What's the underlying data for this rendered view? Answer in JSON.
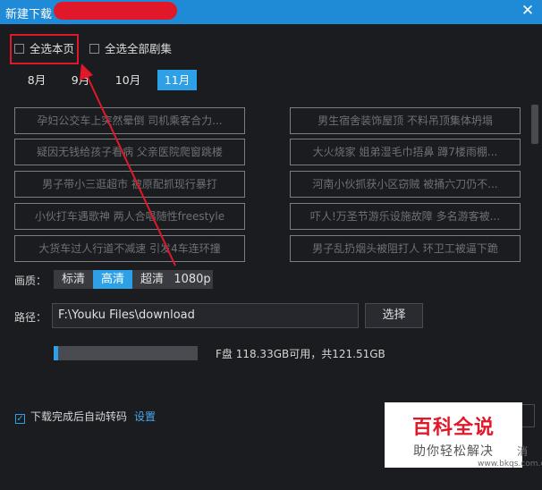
{
  "window": {
    "title": "新建下载",
    "close_glyph": "✕"
  },
  "select": {
    "select_page_label": "全选本页",
    "select_all_series_label": "全选全部剧集"
  },
  "months": [
    {
      "label": "8月",
      "active": false
    },
    {
      "label": "9月",
      "active": false
    },
    {
      "label": "10月",
      "active": false
    },
    {
      "label": "11月",
      "active": true
    }
  ],
  "videos": {
    "left": [
      "孕妇公交车上突然晕倒 司机乘客合力...",
      "疑因无钱给孩子看病 父亲医院爬窗跳楼",
      "男子带小三逛超市 被原配抓现行暴打",
      "小伙打车遇歌神 两人合唱随性freestyle",
      "大货车过人行道不减速 引发4车连环撞"
    ],
    "right": [
      "男生宿舍装饰屋顶 不料吊顶集体坍塌",
      "大火烧家 姐弟湿毛巾捂鼻 蹲7楼雨棚...",
      "河南小伙抓获小区窃贼 被捅六刀仍不...",
      "吓人!万圣节游乐设施故障 多名游客被...",
      "男子乱扔烟头被阻打人 环卫工被逼下跪"
    ]
  },
  "quality": {
    "label": "画质：",
    "options": [
      "标清",
      "高清",
      "超清",
      "1080p"
    ],
    "selected": "高清"
  },
  "path": {
    "label": "路径：",
    "value": "F:\\Youku Files\\download",
    "browse_label": "选择"
  },
  "disk": {
    "used_fraction": 0.03,
    "info": "F盘 118.33GB可用，共121.51GB"
  },
  "auto_transcode": {
    "label": "下载完成后自动转码",
    "checked": true,
    "settings_label": "设置"
  },
  "watermark": {
    "title": "百科全说",
    "subtitle": "助你轻松解决"
  },
  "partial_text": {
    "cut_label": "消",
    "url_tail": "www.bkqs.com.cn"
  },
  "colors": {
    "titlebar": "#1f8ad6",
    "accent": "#2ea0e6",
    "annotation_red": "#e0182a",
    "background": "#1b1c20"
  },
  "icons": [
    "checkbox-icon",
    "close-icon",
    "annotation-arrow"
  ]
}
